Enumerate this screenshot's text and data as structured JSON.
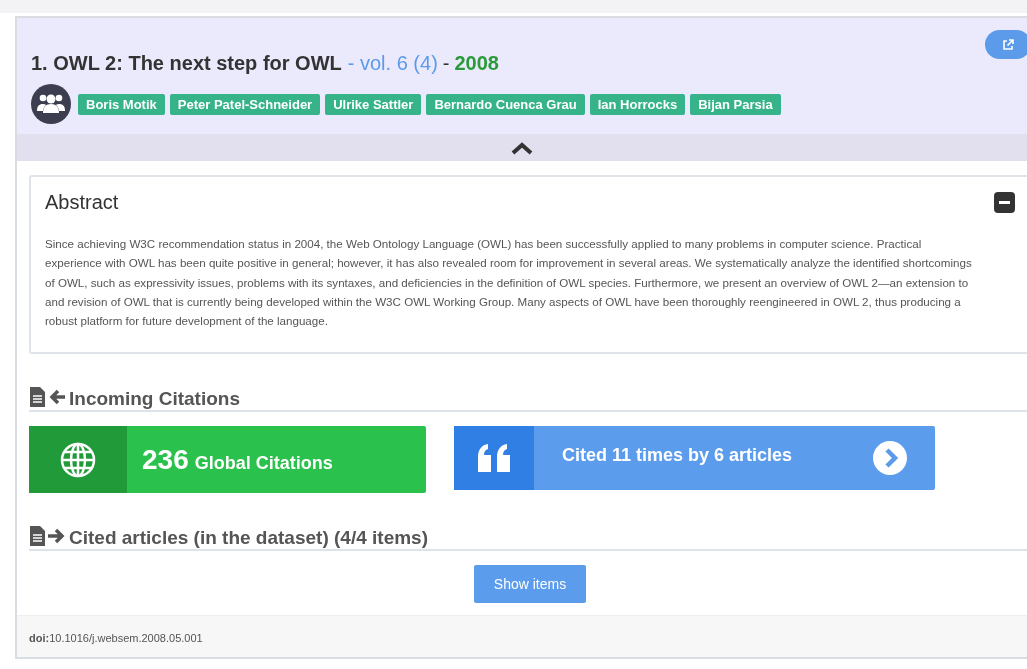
{
  "article": {
    "title": "1. OWL 2: The next step for OWL",
    "volume": "- vol. 6 (4)",
    "separator": "-",
    "year": "2008",
    "authors": [
      "Boris Motik",
      "Peter Patel-Schneider",
      "Ulrike Sattler",
      "Bernardo Cuenca Grau",
      "Ian Horrocks",
      "Bijan Parsia"
    ],
    "expanded": true
  },
  "abstract": {
    "heading": "Abstract",
    "expanded": true,
    "text": "Since achieving W3C recommendation status in 2004, the Web Ontology Language (OWL) has been successfully applied to many problems in computer science. Practical experience with OWL has been quite positive in general; however, it has also revealed room for improvement in several areas. We systematically analyze the identified shortcomings of OWL, such as expressivity issues, problems with its syntaxes, and deficiencies in the definition of OWL species. Furthermore, we present an overview of OWL 2—an extension to and revision of OWL that is currently being developed within the W3C OWL Working Group. Many aspects of OWL have been thoroughly reengineered in OWL 2, thus producing a robust platform for future development of the language."
  },
  "incoming": {
    "heading": "Incoming Citations",
    "global_count": "236",
    "global_label": "Global Citations",
    "cited_text": "Cited 11 times by 6 articles"
  },
  "cited": {
    "heading": "Cited articles (in the dataset) (4/4 items)",
    "button": "Show items"
  },
  "footer": {
    "doi_label": "doi:",
    "doi": "10.1016/j.websem.2008.05.001"
  }
}
